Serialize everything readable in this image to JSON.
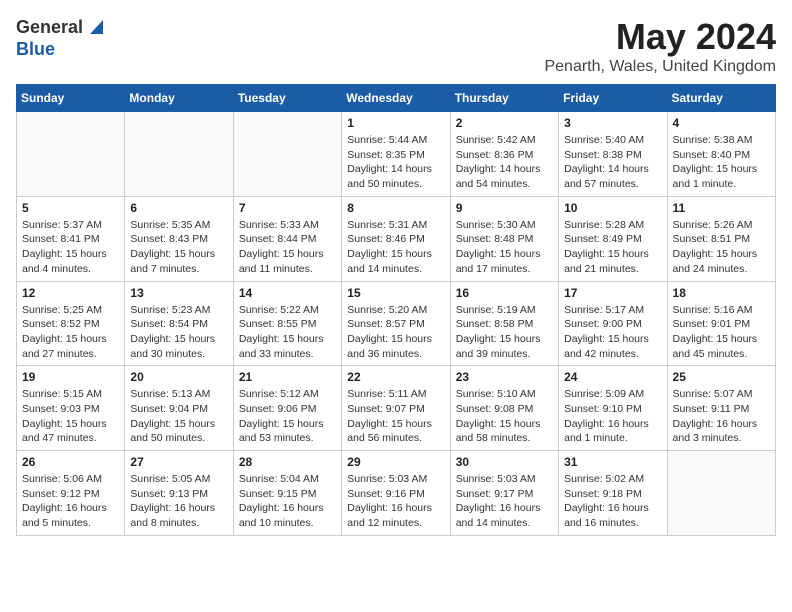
{
  "header": {
    "logo_general": "General",
    "logo_blue": "Blue",
    "month": "May 2024",
    "location": "Penarth, Wales, United Kingdom"
  },
  "weekdays": [
    "Sunday",
    "Monday",
    "Tuesday",
    "Wednesday",
    "Thursday",
    "Friday",
    "Saturday"
  ],
  "weeks": [
    [
      {
        "day": "",
        "info": ""
      },
      {
        "day": "",
        "info": ""
      },
      {
        "day": "",
        "info": ""
      },
      {
        "day": "1",
        "info": "Sunrise: 5:44 AM\nSunset: 8:35 PM\nDaylight: 14 hours\nand 50 minutes."
      },
      {
        "day": "2",
        "info": "Sunrise: 5:42 AM\nSunset: 8:36 PM\nDaylight: 14 hours\nand 54 minutes."
      },
      {
        "day": "3",
        "info": "Sunrise: 5:40 AM\nSunset: 8:38 PM\nDaylight: 14 hours\nand 57 minutes."
      },
      {
        "day": "4",
        "info": "Sunrise: 5:38 AM\nSunset: 8:40 PM\nDaylight: 15 hours\nand 1 minute."
      }
    ],
    [
      {
        "day": "5",
        "info": "Sunrise: 5:37 AM\nSunset: 8:41 PM\nDaylight: 15 hours\nand 4 minutes."
      },
      {
        "day": "6",
        "info": "Sunrise: 5:35 AM\nSunset: 8:43 PM\nDaylight: 15 hours\nand 7 minutes."
      },
      {
        "day": "7",
        "info": "Sunrise: 5:33 AM\nSunset: 8:44 PM\nDaylight: 15 hours\nand 11 minutes."
      },
      {
        "day": "8",
        "info": "Sunrise: 5:31 AM\nSunset: 8:46 PM\nDaylight: 15 hours\nand 14 minutes."
      },
      {
        "day": "9",
        "info": "Sunrise: 5:30 AM\nSunset: 8:48 PM\nDaylight: 15 hours\nand 17 minutes."
      },
      {
        "day": "10",
        "info": "Sunrise: 5:28 AM\nSunset: 8:49 PM\nDaylight: 15 hours\nand 21 minutes."
      },
      {
        "day": "11",
        "info": "Sunrise: 5:26 AM\nSunset: 8:51 PM\nDaylight: 15 hours\nand 24 minutes."
      }
    ],
    [
      {
        "day": "12",
        "info": "Sunrise: 5:25 AM\nSunset: 8:52 PM\nDaylight: 15 hours\nand 27 minutes."
      },
      {
        "day": "13",
        "info": "Sunrise: 5:23 AM\nSunset: 8:54 PM\nDaylight: 15 hours\nand 30 minutes."
      },
      {
        "day": "14",
        "info": "Sunrise: 5:22 AM\nSunset: 8:55 PM\nDaylight: 15 hours\nand 33 minutes."
      },
      {
        "day": "15",
        "info": "Sunrise: 5:20 AM\nSunset: 8:57 PM\nDaylight: 15 hours\nand 36 minutes."
      },
      {
        "day": "16",
        "info": "Sunrise: 5:19 AM\nSunset: 8:58 PM\nDaylight: 15 hours\nand 39 minutes."
      },
      {
        "day": "17",
        "info": "Sunrise: 5:17 AM\nSunset: 9:00 PM\nDaylight: 15 hours\nand 42 minutes."
      },
      {
        "day": "18",
        "info": "Sunrise: 5:16 AM\nSunset: 9:01 PM\nDaylight: 15 hours\nand 45 minutes."
      }
    ],
    [
      {
        "day": "19",
        "info": "Sunrise: 5:15 AM\nSunset: 9:03 PM\nDaylight: 15 hours\nand 47 minutes."
      },
      {
        "day": "20",
        "info": "Sunrise: 5:13 AM\nSunset: 9:04 PM\nDaylight: 15 hours\nand 50 minutes."
      },
      {
        "day": "21",
        "info": "Sunrise: 5:12 AM\nSunset: 9:06 PM\nDaylight: 15 hours\nand 53 minutes."
      },
      {
        "day": "22",
        "info": "Sunrise: 5:11 AM\nSunset: 9:07 PM\nDaylight: 15 hours\nand 56 minutes."
      },
      {
        "day": "23",
        "info": "Sunrise: 5:10 AM\nSunset: 9:08 PM\nDaylight: 15 hours\nand 58 minutes."
      },
      {
        "day": "24",
        "info": "Sunrise: 5:09 AM\nSunset: 9:10 PM\nDaylight: 16 hours\nand 1 minute."
      },
      {
        "day": "25",
        "info": "Sunrise: 5:07 AM\nSunset: 9:11 PM\nDaylight: 16 hours\nand 3 minutes."
      }
    ],
    [
      {
        "day": "26",
        "info": "Sunrise: 5:06 AM\nSunset: 9:12 PM\nDaylight: 16 hours\nand 5 minutes."
      },
      {
        "day": "27",
        "info": "Sunrise: 5:05 AM\nSunset: 9:13 PM\nDaylight: 16 hours\nand 8 minutes."
      },
      {
        "day": "28",
        "info": "Sunrise: 5:04 AM\nSunset: 9:15 PM\nDaylight: 16 hours\nand 10 minutes."
      },
      {
        "day": "29",
        "info": "Sunrise: 5:03 AM\nSunset: 9:16 PM\nDaylight: 16 hours\nand 12 minutes."
      },
      {
        "day": "30",
        "info": "Sunrise: 5:03 AM\nSunset: 9:17 PM\nDaylight: 16 hours\nand 14 minutes."
      },
      {
        "day": "31",
        "info": "Sunrise: 5:02 AM\nSunset: 9:18 PM\nDaylight: 16 hours\nand 16 minutes."
      },
      {
        "day": "",
        "info": ""
      }
    ]
  ]
}
